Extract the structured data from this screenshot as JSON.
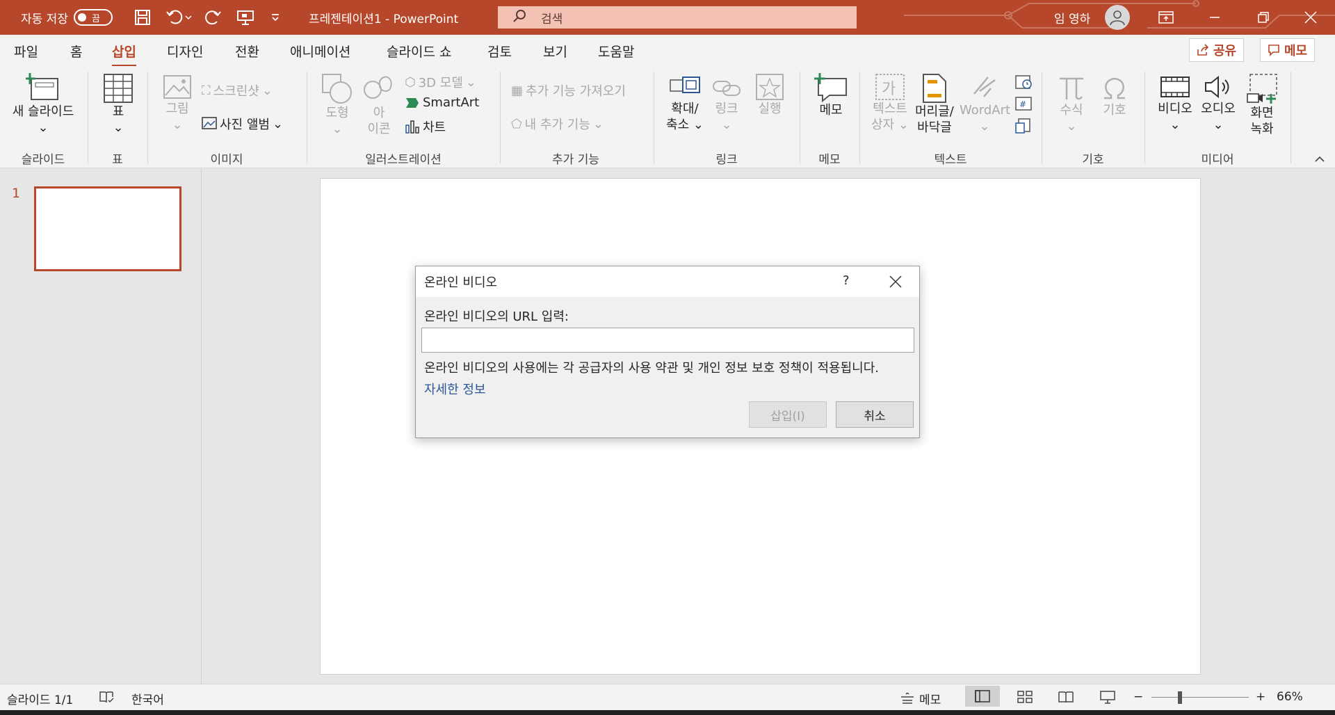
{
  "titlebar": {
    "autosave_label": "자동 저장",
    "autosave_state": "끔",
    "doc_title": "프레젠테이션1  -  PowerPoint",
    "search_placeholder": "검색",
    "user_name": "임 영하"
  },
  "tabs": [
    "파일",
    "홈",
    "삽입",
    "디자인",
    "전환",
    "애니메이션",
    "슬라이드 쇼",
    "검토",
    "보기",
    "도움말"
  ],
  "active_tab": "삽입",
  "share": {
    "share_label": "공유",
    "comment_label": "메모"
  },
  "ribbon": {
    "new_slide": "새 슬라이드",
    "table": "표",
    "picture": "그림",
    "screenshot": "스크린샷",
    "photo_album": "사진 앨범",
    "shapes": "도형",
    "icons_line1": "아",
    "icons_line2": "이콘",
    "model3d": "3D 모델",
    "smartart": "SmartArt",
    "chart": "차트",
    "get_addins": "추가 기능 가져오기",
    "my_addins": "내 추가 기능",
    "zoom_line1": "확대/",
    "zoom_line2": "축소",
    "link": "링크",
    "action": "실행",
    "comment": "메모",
    "textbox_line1": "텍스트",
    "textbox_line2": "상자",
    "header_line1": "머리글/",
    "header_line2": "바닥글",
    "wordart": "WordArt",
    "equation": "수식",
    "symbol": "기호",
    "video": "비디오",
    "audio": "오디오",
    "record_line1": "화면",
    "record_line2": "녹화",
    "groups": {
      "slides": "슬라이드",
      "tables": "표",
      "images": "이미지",
      "illustrations": "일러스트레이션",
      "addins": "추가 기능",
      "links": "링크",
      "comments": "메모",
      "text": "텍스트",
      "symbols": "기호",
      "media": "미디어"
    }
  },
  "slides_pane": {
    "slide_number": "1"
  },
  "dialog": {
    "title": "온라인 비디오",
    "help": "?",
    "url_label": "온라인 비디오의 URL 입력:",
    "url_value": "",
    "notice": "온라인 비디오의 사용에는 각 공급자의 사용 약관 및 개인 정보 보호 정책이 적용됩니다.",
    "more_info": "자세한 정보",
    "insert_label": "삽입(I)",
    "cancel_label": "취소"
  },
  "statusbar": {
    "slide_count": "슬라이드 1/1",
    "language": "한국어",
    "notes": "메모",
    "zoom": "66%"
  },
  "colors": {
    "accent": "#b7472a",
    "ribbon_bg": "#f3f3f3",
    "link": "#2b5797"
  }
}
